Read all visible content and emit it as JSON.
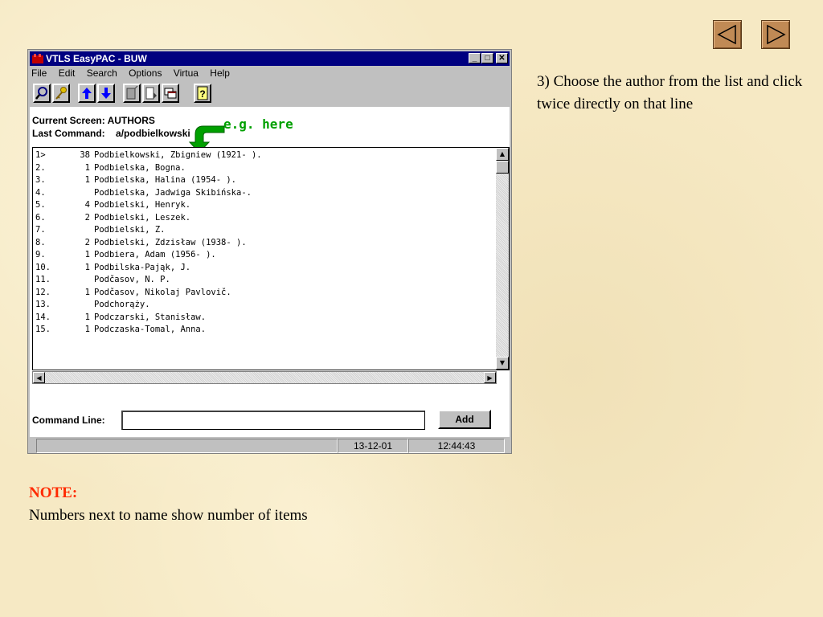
{
  "window": {
    "title": "VTLS EasyPAC - BUW",
    "minimize": "_",
    "maximize": "□",
    "close": "✕"
  },
  "menu": [
    "File",
    "Edit",
    "Search",
    "Options",
    "Virtua",
    "Help"
  ],
  "toolbar_icons": [
    "search-icon",
    "key-icon",
    "arrow-up-icon",
    "arrow-down-icon",
    "document-icon",
    "next-page-icon",
    "windows-icon",
    "help-icon"
  ],
  "screen": {
    "current_screen": "Current Screen: AUTHORS",
    "last_command_label": "Last Command:",
    "last_command_value": "a/podbielkowski"
  },
  "annotation": {
    "text": "e.g. here",
    "color": "#00a000"
  },
  "authors": [
    {
      "num": "1>",
      "count": "38",
      "name": "Podbielkowski, Zbigniew (1921- )."
    },
    {
      "num": "2.",
      "count": "1",
      "name": "Podbielska, Bogna."
    },
    {
      "num": "3.",
      "count": "1",
      "name": "Podbielska, Halina (1954- )."
    },
    {
      "num": "4.",
      "count": "",
      "name": "Podbielska, Jadwiga Skibińska-."
    },
    {
      "num": "5.",
      "count": "4",
      "name": "Podbielski, Henryk."
    },
    {
      "num": "6.",
      "count": "2",
      "name": "Podbielski, Leszek."
    },
    {
      "num": "7.",
      "count": "",
      "name": "Podbielski, Z."
    },
    {
      "num": "8.",
      "count": "2",
      "name": "Podbielski, Zdzisław (1938- )."
    },
    {
      "num": "9.",
      "count": "1",
      "name": "Podbiera, Adam (1956- )."
    },
    {
      "num": "10.",
      "count": "1",
      "name": "Podbilska-Pająk, J."
    },
    {
      "num": "11.",
      "count": "",
      "name": "Podčasov, N. P."
    },
    {
      "num": "12.",
      "count": "1",
      "name": "Podčasov, Nikolaj Pavlovič."
    },
    {
      "num": "13.",
      "count": "",
      "name": "Podchorąży."
    },
    {
      "num": "14.",
      "count": "1",
      "name": "Podczarski, Stanisław."
    },
    {
      "num": "15.",
      "count": "1",
      "name": "Podczaska-Tomal, Anna."
    }
  ],
  "command_line": {
    "label": "Command Line:",
    "value": "",
    "add_label": "Add"
  },
  "status": {
    "date": "13-12-01",
    "time": "12:44:43"
  },
  "slide": {
    "instruction": "3) Choose the author from the list and click twice directly on that line",
    "note_title": "NOTE:",
    "note_text": "Numbers next to name show number of items"
  },
  "nav": {
    "prev": "previous-slide-icon",
    "next": "next-slide-icon"
  }
}
